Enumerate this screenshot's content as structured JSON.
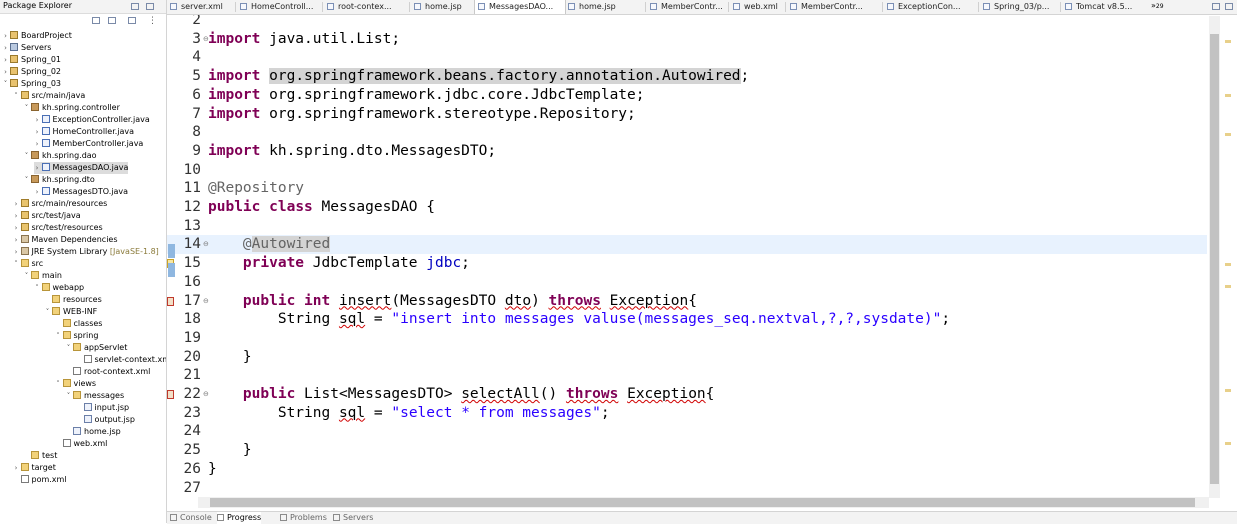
{
  "package_explorer": {
    "title": "Package Explorer",
    "tree": [
      {
        "label": "BoardProject",
        "icon": "project-icon",
        "twisty": "collapsed",
        "depth": 0
      },
      {
        "label": "Servers",
        "icon": "servers-icon",
        "twisty": "collapsed",
        "depth": 0
      },
      {
        "label": "Spring_01",
        "icon": "project-icon",
        "twisty": "collapsed",
        "depth": 0
      },
      {
        "label": "Spring_02",
        "icon": "project-icon",
        "twisty": "collapsed",
        "depth": 0
      },
      {
        "label": "Spring_03",
        "icon": "project-icon",
        "twisty": "expanded",
        "depth": 0
      },
      {
        "label": "src/main/java",
        "icon": "source-folder-icon",
        "twisty": "expanded",
        "depth": 1
      },
      {
        "label": "kh.spring.controller",
        "icon": "package-icon",
        "twisty": "expanded",
        "depth": 2
      },
      {
        "label": "ExceptionController.java",
        "icon": "java-file-icon",
        "twisty": "collapsed",
        "depth": 3
      },
      {
        "label": "HomeController.java",
        "icon": "java-file-icon",
        "twisty": "collapsed",
        "depth": 3
      },
      {
        "label": "MemberController.java",
        "icon": "java-file-icon",
        "twisty": "collapsed",
        "depth": 3
      },
      {
        "label": "kh.spring.dao",
        "icon": "package-icon",
        "twisty": "expanded",
        "depth": 2
      },
      {
        "label": "MessagesDAO.java",
        "icon": "java-file-icon",
        "twisty": "collapsed",
        "depth": 3,
        "selected": true
      },
      {
        "label": "kh.spring.dto",
        "icon": "package-icon",
        "twisty": "expanded",
        "depth": 2
      },
      {
        "label": "MessagesDTO.java",
        "icon": "java-file-icon",
        "twisty": "collapsed",
        "depth": 3
      },
      {
        "label": "src/main/resources",
        "icon": "source-folder-icon",
        "twisty": "collapsed",
        "depth": 1
      },
      {
        "label": "src/test/java",
        "icon": "source-folder-icon",
        "twisty": "collapsed",
        "depth": 1
      },
      {
        "label": "src/test/resources",
        "icon": "source-folder-icon",
        "twisty": "collapsed",
        "depth": 1
      },
      {
        "label": "Maven Dependencies",
        "icon": "library-icon",
        "twisty": "collapsed",
        "depth": 1
      },
      {
        "label": "JRE System Library",
        "note": "[JavaSE-1.8]",
        "icon": "library-icon",
        "twisty": "collapsed",
        "depth": 1
      },
      {
        "label": "src",
        "icon": "folder-icon",
        "twisty": "expanded",
        "depth": 1
      },
      {
        "label": "main",
        "icon": "folder-icon",
        "twisty": "expanded",
        "depth": 2
      },
      {
        "label": "webapp",
        "icon": "folder-icon",
        "twisty": "expanded",
        "depth": 3
      },
      {
        "label": "resources",
        "icon": "folder-icon",
        "twisty": "none",
        "depth": 4
      },
      {
        "label": "WEB-INF",
        "icon": "folder-icon",
        "twisty": "expanded",
        "depth": 4
      },
      {
        "label": "classes",
        "icon": "folder-icon",
        "twisty": "none",
        "depth": 5
      },
      {
        "label": "spring",
        "icon": "folder-icon",
        "twisty": "expanded",
        "depth": 5
      },
      {
        "label": "appServlet",
        "icon": "folder-icon",
        "twisty": "expanded",
        "depth": 6
      },
      {
        "label": "servlet-context.xm",
        "icon": "xml-file-icon",
        "twisty": "none",
        "depth": 7
      },
      {
        "label": "root-context.xml",
        "icon": "xml-file-icon",
        "twisty": "none",
        "depth": 6
      },
      {
        "label": "views",
        "icon": "folder-icon",
        "twisty": "expanded",
        "depth": 5
      },
      {
        "label": "messages",
        "icon": "folder-icon",
        "twisty": "expanded",
        "depth": 6
      },
      {
        "label": "input.jsp",
        "icon": "jsp-file-icon",
        "twisty": "none",
        "depth": 7
      },
      {
        "label": "output.jsp",
        "icon": "jsp-file-icon",
        "twisty": "none",
        "depth": 7
      },
      {
        "label": "home.jsp",
        "icon": "jsp-file-icon",
        "twisty": "none",
        "depth": 6
      },
      {
        "label": "web.xml",
        "icon": "xml-file-icon",
        "twisty": "none",
        "depth": 5
      },
      {
        "label": "test",
        "icon": "folder-icon",
        "twisty": "none",
        "depth": 2
      },
      {
        "label": "target",
        "icon": "folder-icon",
        "twisty": "collapsed",
        "depth": 1
      },
      {
        "label": "pom.xml",
        "icon": "xml-file-icon",
        "twisty": "none",
        "depth": 1
      }
    ]
  },
  "editor_tabs": {
    "tabs": [
      {
        "label": "server.xml",
        "active": false
      },
      {
        "label": "HomeControll...",
        "active": false
      },
      {
        "label": "root-contex...",
        "active": false
      },
      {
        "label": "home.jsp",
        "active": false
      },
      {
        "label": "MessagesDAO...",
        "active": true
      },
      {
        "label": "home.jsp",
        "active": false
      },
      {
        "label": "MemberContr...",
        "active": false
      },
      {
        "label": "web.xml",
        "active": false
      },
      {
        "label": "MemberContr...",
        "active": false
      },
      {
        "label": "ExceptionCon...",
        "active": false
      },
      {
        "label": "Spring_03/p...",
        "active": false
      },
      {
        "label": "Tomcat v8.5...",
        "active": false
      }
    ],
    "overflow_label": "»",
    "overflow_count": "29"
  },
  "editor": {
    "current_line": 14,
    "lines": [
      {
        "n": "2",
        "tokens": []
      },
      {
        "n": "3",
        "tokens": [
          {
            "t": "import",
            "c": "kw"
          },
          {
            "t": " java.util.List;"
          }
        ],
        "marker": "fold"
      },
      {
        "n": "4",
        "tokens": []
      },
      {
        "n": "5",
        "tokens": [
          {
            "t": "import",
            "c": "kw"
          },
          {
            "t": " "
          },
          {
            "t": "org.springframework.beans.factory.annotation.Autowired",
            "c": "occ"
          },
          {
            "t": ";"
          }
        ]
      },
      {
        "n": "6",
        "tokens": [
          {
            "t": "import",
            "c": "kw"
          },
          {
            "t": " org.springframework.jdbc.core.JdbcTemplate;"
          }
        ]
      },
      {
        "n": "7",
        "tokens": [
          {
            "t": "import",
            "c": "kw"
          },
          {
            "t": " org.springframework.stereotype.Repository;"
          }
        ]
      },
      {
        "n": "8",
        "tokens": []
      },
      {
        "n": "9",
        "tokens": [
          {
            "t": "import",
            "c": "kw"
          },
          {
            "t": " kh.spring.dto.MessagesDTO;"
          }
        ]
      },
      {
        "n": "10",
        "tokens": []
      },
      {
        "n": "11",
        "tokens": [
          {
            "t": "@Repository",
            "c": "ann"
          }
        ]
      },
      {
        "n": "12",
        "tokens": [
          {
            "t": "public",
            "c": "kw"
          },
          {
            "t": " "
          },
          {
            "t": "class",
            "c": "kw"
          },
          {
            "t": " MessagesDAO {"
          }
        ]
      },
      {
        "n": "13",
        "tokens": []
      },
      {
        "n": "14",
        "tokens": [
          {
            "t": "    "
          },
          {
            "t": "@",
            "c": "ann"
          },
          {
            "t": "Autowired",
            "c": "ann occ"
          }
        ],
        "marker": "fold"
      },
      {
        "n": "15",
        "tokens": [
          {
            "t": "    "
          },
          {
            "t": "private",
            "c": "kw"
          },
          {
            "t": " JdbcTemplate "
          },
          {
            "t": "jdbc",
            "c": "fld"
          },
          {
            "t": ";"
          }
        ],
        "marker": "warning"
      },
      {
        "n": "16",
        "tokens": []
      },
      {
        "n": "17",
        "tokens": [
          {
            "t": "    "
          },
          {
            "t": "public",
            "c": "kw"
          },
          {
            "t": " "
          },
          {
            "t": "int",
            "c": "kw"
          },
          {
            "t": " "
          },
          {
            "t": "insert",
            "c": "squig"
          },
          {
            "t": "(MessagesDTO "
          },
          {
            "t": "dto",
            "c": "squig"
          },
          {
            "t": ") "
          },
          {
            "t": "throws",
            "c": "kw squig"
          },
          {
            "t": " "
          },
          {
            "t": "Exception",
            "c": "squig"
          },
          {
            "t": "{"
          }
        ],
        "marker": "error"
      },
      {
        "n": "18",
        "tokens": [
          {
            "t": "        String "
          },
          {
            "t": "sql",
            "c": "squig"
          },
          {
            "t": " = "
          },
          {
            "t": "\"insert into messages valuse(messages_seq.nextval,?,?,sysdate)\"",
            "c": "str"
          },
          {
            "t": ";"
          }
        ]
      },
      {
        "n": "19",
        "tokens": []
      },
      {
        "n": "20",
        "tokens": [
          {
            "t": "    }"
          }
        ]
      },
      {
        "n": "21",
        "tokens": []
      },
      {
        "n": "22",
        "tokens": [
          {
            "t": "    "
          },
          {
            "t": "public",
            "c": "kw"
          },
          {
            "t": " List<MessagesDTO> "
          },
          {
            "t": "selectAll",
            "c": "squig"
          },
          {
            "t": "() "
          },
          {
            "t": "throws",
            "c": "kw squig"
          },
          {
            "t": " "
          },
          {
            "t": "Exception",
            "c": "squig"
          },
          {
            "t": "{"
          }
        ],
        "marker": "error"
      },
      {
        "n": "23",
        "tokens": [
          {
            "t": "        String "
          },
          {
            "t": "sql",
            "c": "squig"
          },
          {
            "t": " = "
          },
          {
            "t": "\"select * from messages\"",
            "c": "str"
          },
          {
            "t": ";"
          }
        ]
      },
      {
        "n": "24",
        "tokens": []
      },
      {
        "n": "25",
        "tokens": [
          {
            "t": "    }"
          }
        ]
      },
      {
        "n": "26",
        "tokens": [
          {
            "t": "}"
          }
        ]
      },
      {
        "n": "27",
        "tokens": []
      }
    ]
  },
  "bottom_tabs": [
    {
      "label": "Console",
      "active": false
    },
    {
      "label": "Progress",
      "active": true
    },
    {
      "label": "Problems",
      "active": false
    },
    {
      "label": "Servers",
      "active": false
    }
  ],
  "colors": {
    "keyword": "#7f0055",
    "string": "#2a00ff",
    "annotation": "#646464",
    "field": "#0000c0",
    "current_line": "#e8f2fe"
  }
}
